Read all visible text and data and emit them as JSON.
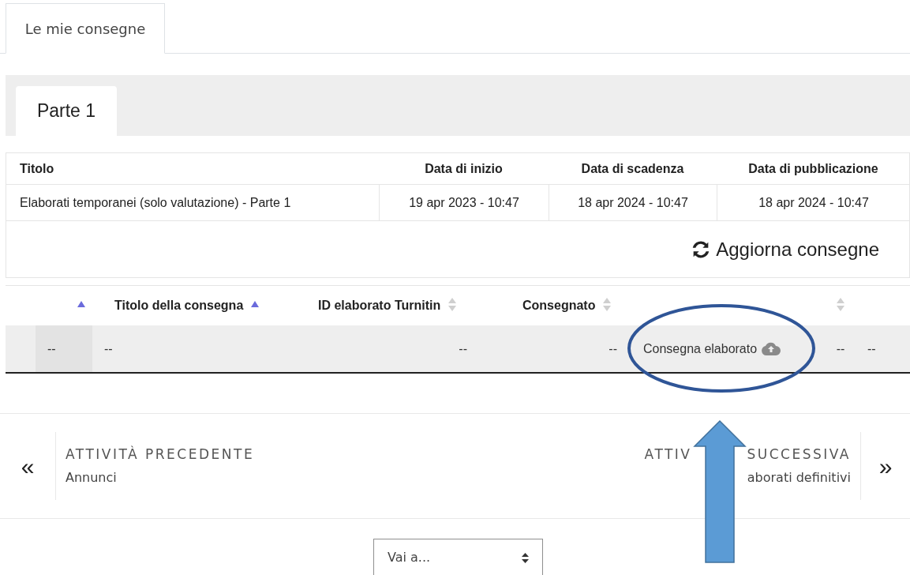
{
  "tabs": [
    {
      "label": "Le mie consegne",
      "selected": true
    }
  ],
  "part_tabs": [
    {
      "label": "Parte 1",
      "selected": true
    }
  ],
  "assignments": {
    "columns": [
      "Titolo",
      "Data di inizio",
      "Data di scadenza",
      "Data di pubblicazione"
    ],
    "rows": [
      [
        "Elaborati temporanei (solo valutazione) - Parte 1",
        "19 apr 2023 - 10:47",
        "18 apr 2024 - 10:47",
        "18 apr 2024 - 10:47"
      ]
    ]
  },
  "refresh_button": "Aggiorna consegne",
  "submissions": {
    "columns": [
      {
        "sorted": true
      },
      {
        "label": "Titolo della consegna",
        "sorted": true
      },
      {
        "label": "ID elaborato Turnitin",
        "sorted": false
      },
      {
        "label": "Consegnato",
        "sorted": false
      },
      {
        "sorted": false
      }
    ],
    "rows": [
      [
        {
          "kind": "text",
          "text": "--"
        },
        {
          "kind": "text",
          "text": "--"
        },
        {
          "kind": "text",
          "text": "--"
        },
        {
          "kind": "text",
          "text": "--"
        },
        {
          "kind": "upload",
          "text": "Consegna elaborato"
        },
        {
          "kind": "text",
          "text": "--"
        },
        {
          "kind": "text",
          "text": "--"
        }
      ]
    ]
  },
  "navigation": {
    "previous": {
      "label": "ATTIVITÀ PRECEDENTE",
      "title": "Annunci",
      "symbol": "«"
    },
    "next": {
      "label_parts": [
        "ATTIV",
        "SUCCESSIVA"
      ],
      "title": "aborati definitivi",
      "symbol": "»"
    }
  },
  "jump_select": {
    "value": "Vai a..."
  }
}
